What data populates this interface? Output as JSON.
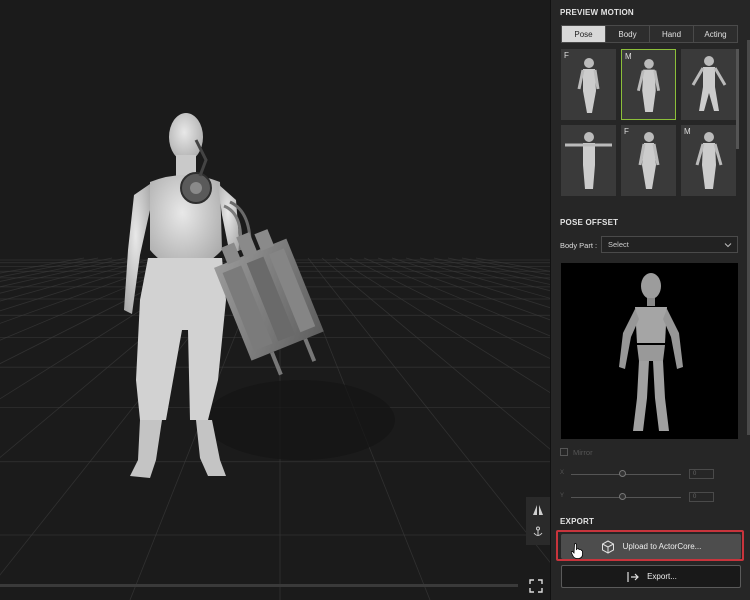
{
  "preview_motion": {
    "title": "PREVIEW MOTION",
    "tabs": [
      {
        "label": "Pose",
        "active": true
      },
      {
        "label": "Body",
        "active": false
      },
      {
        "label": "Hand",
        "active": false
      },
      {
        "label": "Acting",
        "active": false
      }
    ],
    "thumbnails": [
      {
        "tag": "F",
        "selected": false
      },
      {
        "tag": "M",
        "selected": true
      },
      {
        "tag": "",
        "selected": false
      },
      {
        "tag": "",
        "selected": false
      },
      {
        "tag": "F",
        "selected": false
      },
      {
        "tag": "M",
        "selected": false
      }
    ]
  },
  "pose_offset": {
    "title": "POSE OFFSET",
    "body_part_label": "Body Part :",
    "body_part_value": "Select",
    "mirror_label": "Mirror",
    "sliders": [
      {
        "axis": "X",
        "value": "0"
      },
      {
        "axis": "Y",
        "value": "0"
      }
    ]
  },
  "export": {
    "title": "EXPORT",
    "upload_label": "Upload to ActorCore...",
    "export_label": "Export..."
  },
  "colors": {
    "accent_selected": "#8cbf3a",
    "highlight": "#c8343c",
    "panel_bg": "#262626",
    "viewport_bg": "#1b1b1b"
  },
  "icons": {
    "view_tool_top": "mirror-triangles-icon",
    "view_tool_bottom": "anchor-icon",
    "fullscreen": "fullscreen-icon",
    "upload": "actorcore-cube-icon",
    "export": "export-arrow-icon",
    "dropdown": "chevron-down-icon",
    "cursor": "hand-pointer-icon"
  }
}
